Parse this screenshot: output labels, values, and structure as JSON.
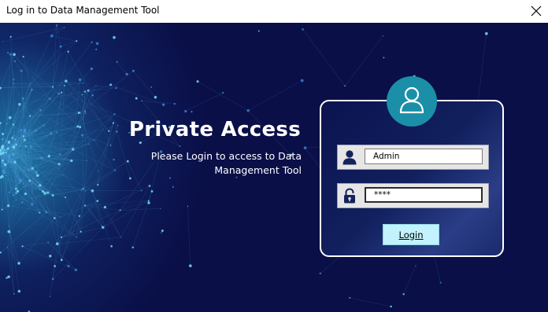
{
  "window": {
    "title": "Log in to Data Management Tool",
    "close_symbol": "✕"
  },
  "hero": {
    "heading": "Private Access",
    "subtext": "Please Login to access to Data Management Tool"
  },
  "login_panel": {
    "avatar_icon": "user-avatar-icon",
    "username": {
      "icon": "user-icon",
      "value": "Admin"
    },
    "password": {
      "icon": "lock-icon",
      "value": "****"
    },
    "login_button_label": "Login"
  },
  "colors": {
    "background": "#0a0f48",
    "accent": "#1b8fa8",
    "button": "#c2f2fb",
    "panel_border": "#ffffff"
  }
}
